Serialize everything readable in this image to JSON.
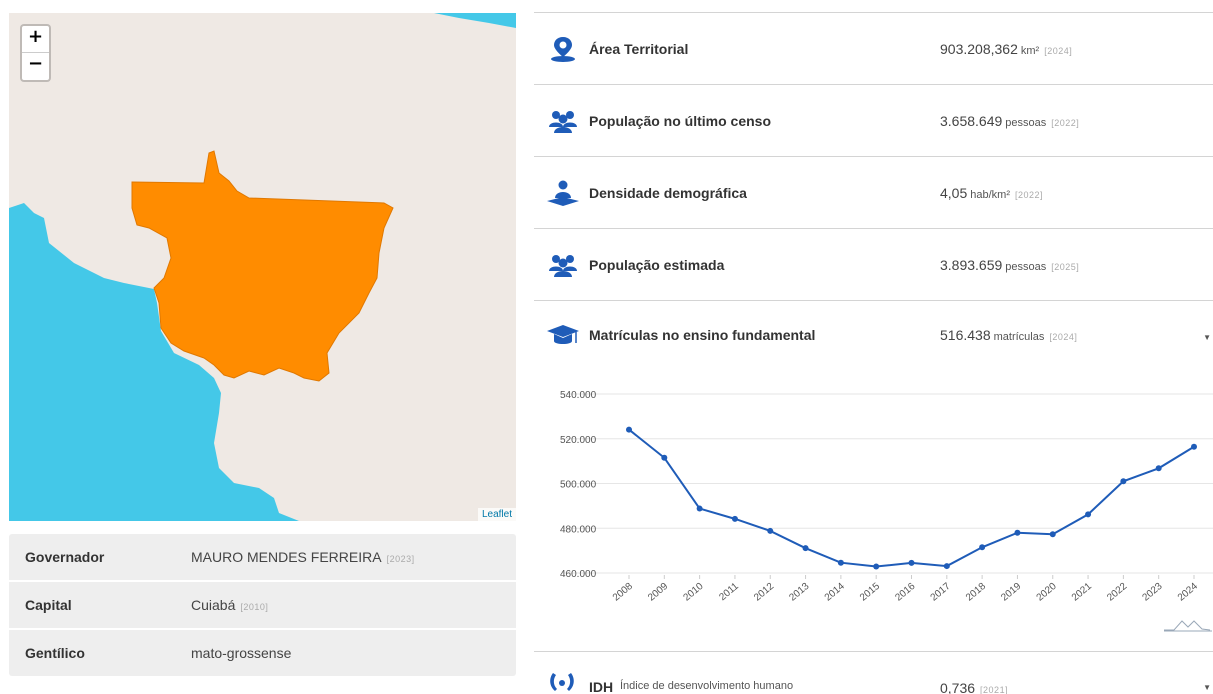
{
  "map": {
    "zoom_in": "+",
    "zoom_out": "−",
    "attribution": "Leaflet",
    "colors": {
      "land": "#efe9e4",
      "water": "#44c8e8",
      "highlight": "#ff8c00"
    }
  },
  "info": {
    "rows": [
      {
        "label": "Governador",
        "value": "MAURO MENDES FERREIRA",
        "year": "[2023]"
      },
      {
        "label": "Capital",
        "value": "Cuiabá",
        "year": "[2010]"
      },
      {
        "label": "Gentílico",
        "value": "mato-grossense",
        "year": ""
      }
    ]
  },
  "indicators": [
    {
      "icon": "map-pin-icon",
      "name": "Área Territorial",
      "value": "903.208,362",
      "unit": "km²",
      "year": "[2024]"
    },
    {
      "icon": "people-group-icon",
      "name": "População no último censo",
      "value": "3.658.649",
      "unit": "pessoas",
      "year": "[2022]"
    },
    {
      "icon": "person-density-icon",
      "name": "Densidade demográfica",
      "value": "4,05",
      "unit": "hab/km²",
      "year": "[2022]"
    },
    {
      "icon": "people-group-icon",
      "name": "População estimada",
      "value": "3.893.659",
      "unit": "pessoas",
      "year": "[2025]"
    },
    {
      "icon": "graduation-cap-icon",
      "name": "Matrículas no ensino fundamental",
      "value": "516.438",
      "unit": "matrículas",
      "year": "[2024]"
    }
  ],
  "idh": {
    "icon": "laurel-icon",
    "name": "IDH",
    "subtitle": "Índice de desenvolvimento humano",
    "value": "0,736",
    "year": "[2021]"
  },
  "accent_color": "#1f5cb8",
  "chart_data": {
    "type": "line",
    "title": "",
    "xlabel": "",
    "ylabel": "",
    "ylim": [
      460000,
      540000
    ],
    "yticks": [
      "460.000",
      "480.000",
      "500.000",
      "520.000",
      "540.000"
    ],
    "grid": true,
    "x": [
      "2008",
      "2009",
      "2010",
      "2011",
      "2012",
      "2013",
      "2014",
      "2015",
      "2016",
      "2017",
      "2018",
      "2019",
      "2020",
      "2021",
      "2022",
      "2023",
      "2024"
    ],
    "series": [
      {
        "values": [
          524100,
          511500,
          488800,
          484200,
          478800,
          471100,
          464600,
          462900,
          464500,
          463100,
          471500,
          478000,
          477300,
          486200,
          501000,
          506800,
          516438
        ]
      }
    ]
  }
}
